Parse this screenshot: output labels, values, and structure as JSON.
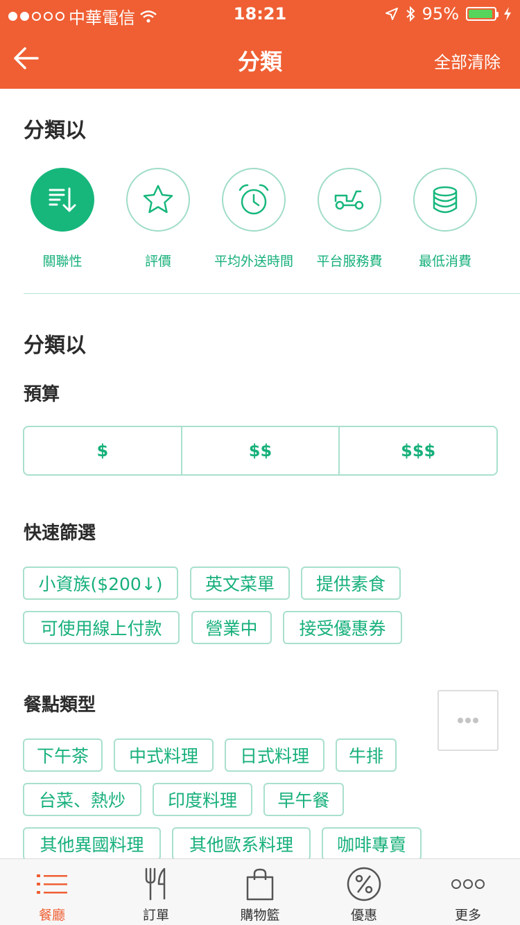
{
  "status_bar": {
    "carrier": "中華電信",
    "time": "18:21",
    "battery": "95%"
  },
  "nav": {
    "title": "分類",
    "clear_all": "全部清除"
  },
  "sort_section": {
    "title": "分類以",
    "options": [
      {
        "label": "關聯性",
        "icon": "relevance-icon",
        "active": true
      },
      {
        "label": "評價",
        "icon": "star-icon",
        "active": false
      },
      {
        "label": "平均外送時間",
        "icon": "alarm-clock-icon",
        "active": false
      },
      {
        "label": "平台服務費",
        "icon": "scooter-icon",
        "active": false
      },
      {
        "label": "最低消費",
        "icon": "coins-icon",
        "active": false
      }
    ]
  },
  "filter_section": {
    "title": "分類以",
    "budget": {
      "title": "預算",
      "options": [
        "$",
        "$$",
        "$$$"
      ]
    },
    "quick_filters": {
      "title": "快速篩選",
      "chips": [
        "小資族($200↓)",
        "英文菜單",
        "提供素食",
        "可使用線上付款",
        "營業中",
        "接受優惠券"
      ]
    },
    "cuisines": {
      "title": "餐點類型",
      "chips": [
        "下午茶",
        "中式料理",
        "日式料理",
        "牛排",
        "台菜、熱炒",
        "印度料理",
        "早午餐",
        "其他異國料理",
        "其他歐系料理",
        "咖啡專賣"
      ]
    }
  },
  "tabbar": {
    "tabs": [
      {
        "label": "餐廳",
        "icon": "list-icon",
        "active": true
      },
      {
        "label": "訂單",
        "icon": "fork-knife-icon",
        "active": false
      },
      {
        "label": "購物籃",
        "icon": "shopping-bag-icon",
        "active": false
      },
      {
        "label": "優惠",
        "icon": "percent-icon",
        "active": false
      },
      {
        "label": "更多",
        "icon": "more-dots-icon",
        "active": false
      }
    ]
  },
  "colors": {
    "brand_orange": "#ef5f33",
    "accent_green": "#17b77c",
    "chip_border": "#a8e0cc"
  }
}
